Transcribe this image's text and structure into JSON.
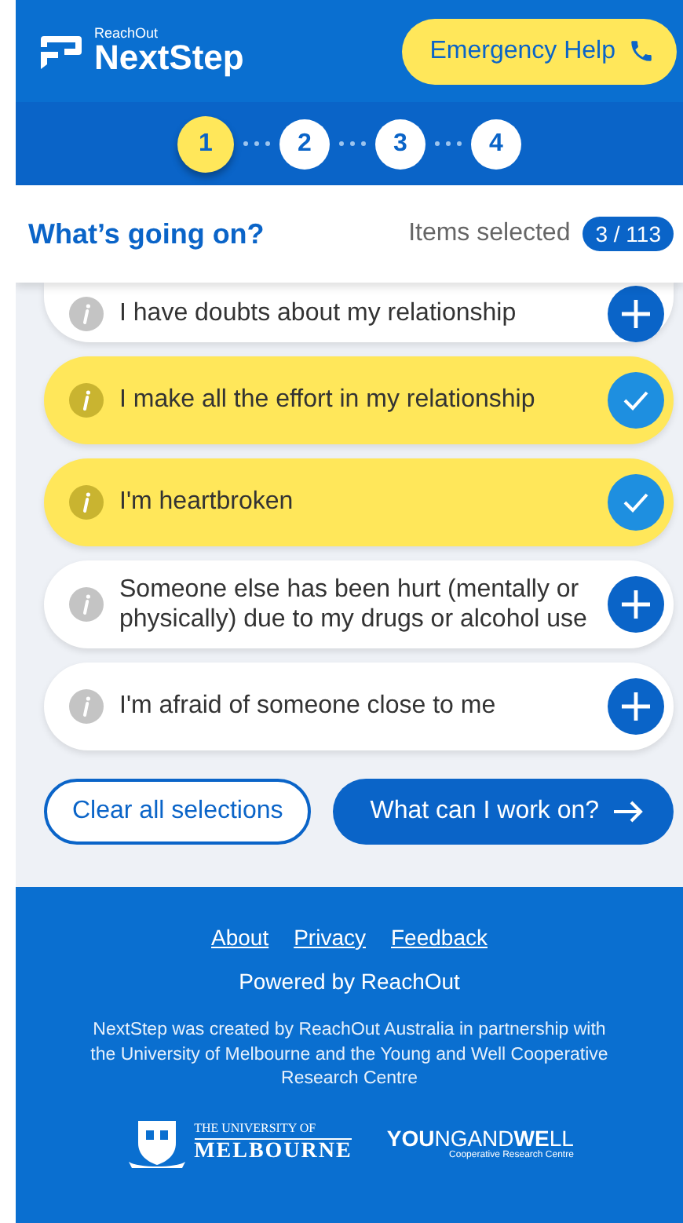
{
  "header": {
    "logo_small": "ReachOut",
    "logo_big": "NextStep",
    "emergency_button": "Emergency Help"
  },
  "steps": [
    {
      "label": "1",
      "selected": true
    },
    {
      "label": "2",
      "selected": false
    },
    {
      "label": "3",
      "selected": false
    },
    {
      "label": "4",
      "selected": false
    }
  ],
  "section": {
    "title": "What’s going on?",
    "count_label": "Items selected",
    "count": "3 / 113"
  },
  "items": [
    {
      "text": "I have doubts about my relationship",
      "selected": false
    },
    {
      "text": "I make all the effort in my relationship",
      "selected": true
    },
    {
      "text": "I'm heartbroken",
      "selected": true
    },
    {
      "text": "Someone else has been hurt (mentally or physically) due to my drugs or alcohol use",
      "selected": false
    },
    {
      "text": "I'm afraid of someone close to me",
      "selected": false
    }
  ],
  "actions": {
    "clear": "Clear all selections",
    "next": "What can I work on?"
  },
  "footer": {
    "links": [
      "About",
      "Privacy",
      "Feedback"
    ],
    "powered": "Powered by ReachOut",
    "credit": "NextStep was created by ReachOut Australia in partnership with the University of Melbourne and the Young and Well Cooperative Research Centre",
    "uni_top": "THE UNIVERSITY OF",
    "uni_bottom": "MELBOURNE",
    "yaw": "**YOU**NGAND**WE**LL",
    "yaw_sub": "Cooperative Research Centre"
  }
}
